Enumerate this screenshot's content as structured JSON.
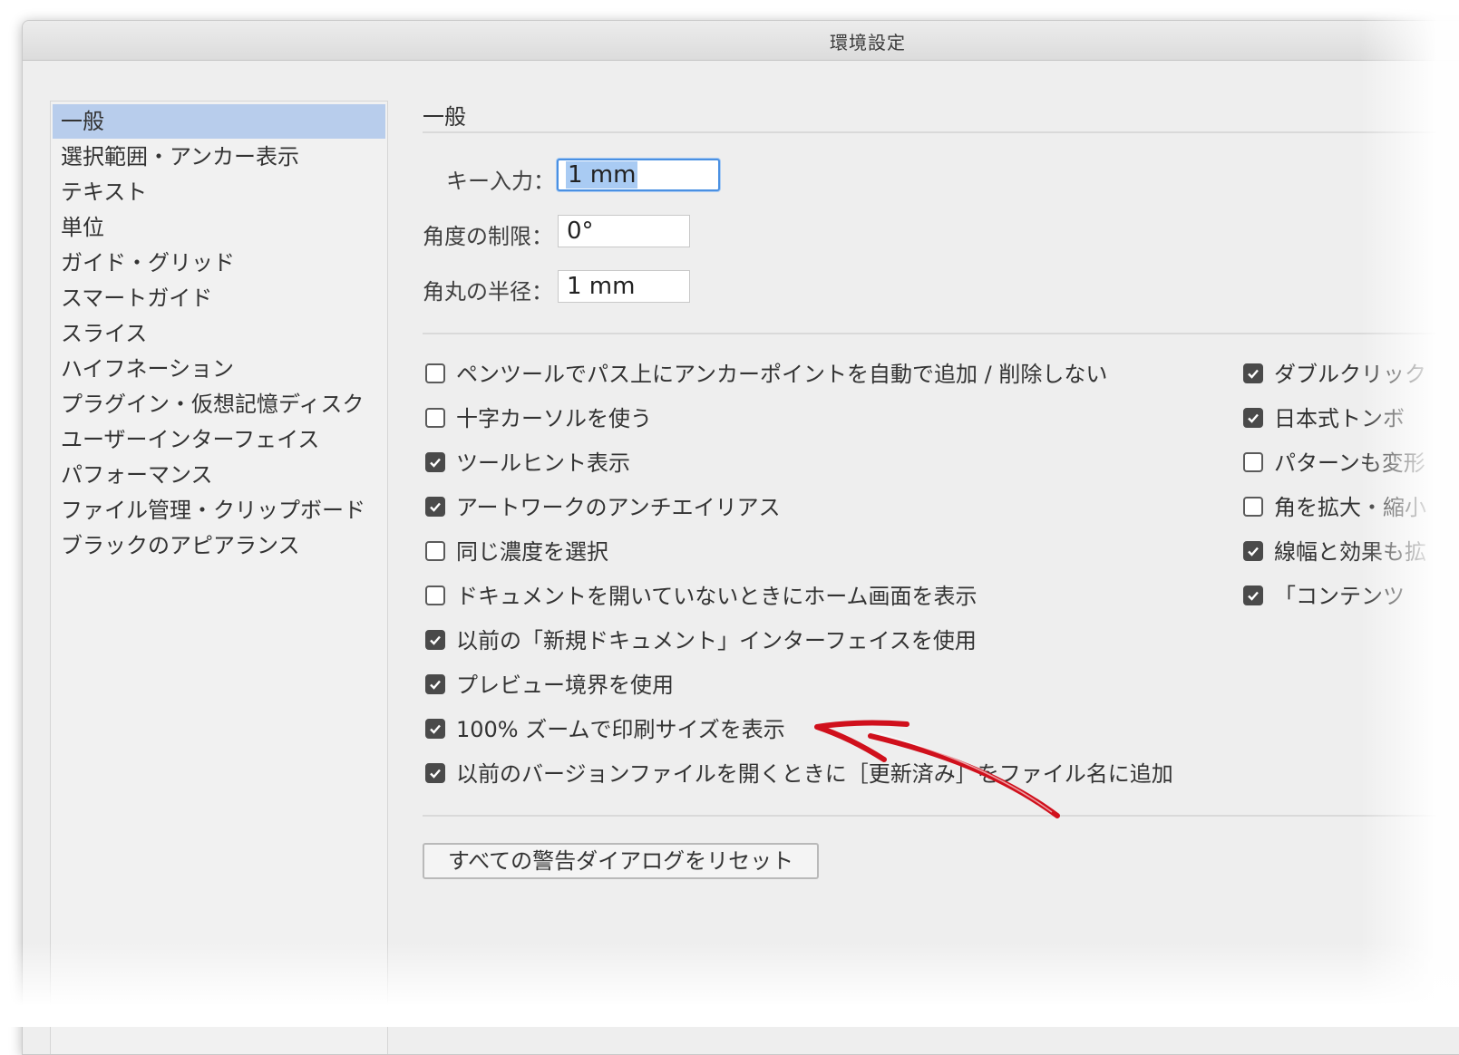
{
  "window": {
    "title": "環境設定"
  },
  "sidebar": {
    "items": [
      {
        "label": "一般",
        "selected": true
      },
      {
        "label": "選択範囲・アンカー表示",
        "selected": false
      },
      {
        "label": "テキスト",
        "selected": false
      },
      {
        "label": "単位",
        "selected": false
      },
      {
        "label": "ガイド・グリッド",
        "selected": false
      },
      {
        "label": "スマートガイド",
        "selected": false
      },
      {
        "label": "スライス",
        "selected": false
      },
      {
        "label": "ハイフネーション",
        "selected": false
      },
      {
        "label": "プラグイン・仮想記憶ディスク",
        "selected": false
      },
      {
        "label": "ユーザーインターフェイス",
        "selected": false
      },
      {
        "label": "パフォーマンス",
        "selected": false
      },
      {
        "label": "ファイル管理・クリップボード",
        "selected": false
      },
      {
        "label": "ブラックのアピアランス",
        "selected": false
      }
    ]
  },
  "general": {
    "section_title": "一般",
    "key_input": {
      "label": "キー入力：",
      "value": "1 mm"
    },
    "angle_limit": {
      "label": "角度の制限：",
      "value": "0°"
    },
    "corner_radius": {
      "label": "角丸の半径：",
      "value": "1 mm"
    },
    "left_options": [
      {
        "label": "ペンツールでパス上にアンカーポイントを自動で追加 / 削除しない",
        "checked": false
      },
      {
        "label": "十字カーソルを使う",
        "checked": false
      },
      {
        "label": "ツールヒント表示",
        "checked": true
      },
      {
        "label": "アートワークのアンチエイリアス",
        "checked": true
      },
      {
        "label": "同じ濃度を選択",
        "checked": false
      },
      {
        "label": "ドキュメントを開いていないときにホーム画面を表示",
        "checked": false
      },
      {
        "label": "以前の「新規ドキュメント」インターフェイスを使用",
        "checked": true
      },
      {
        "label": "プレビュー境界を使用",
        "checked": true
      },
      {
        "label": "100% ズームで印刷サイズを表示",
        "checked": true
      },
      {
        "label": "以前のバージョンファイルを開くときに［更新済み］をファイル名に追加",
        "checked": true
      }
    ],
    "right_options": [
      {
        "label": "ダブルクリック",
        "checked": true
      },
      {
        "label": "日本式トンボ",
        "checked": true
      },
      {
        "label": "パターンも変形",
        "checked": false
      },
      {
        "label": "角を拡大・縮小",
        "checked": false
      },
      {
        "label": "線幅と効果も拡",
        "checked": true
      },
      {
        "label": "「コンテンツ",
        "checked": true
      }
    ],
    "reset_button": "すべての警告ダイアログをリセット"
  },
  "colors": {
    "selection_highlight": "#b8cdec",
    "focus_ring": "#4a90e2",
    "annotation_arrow": "#d0101c"
  }
}
